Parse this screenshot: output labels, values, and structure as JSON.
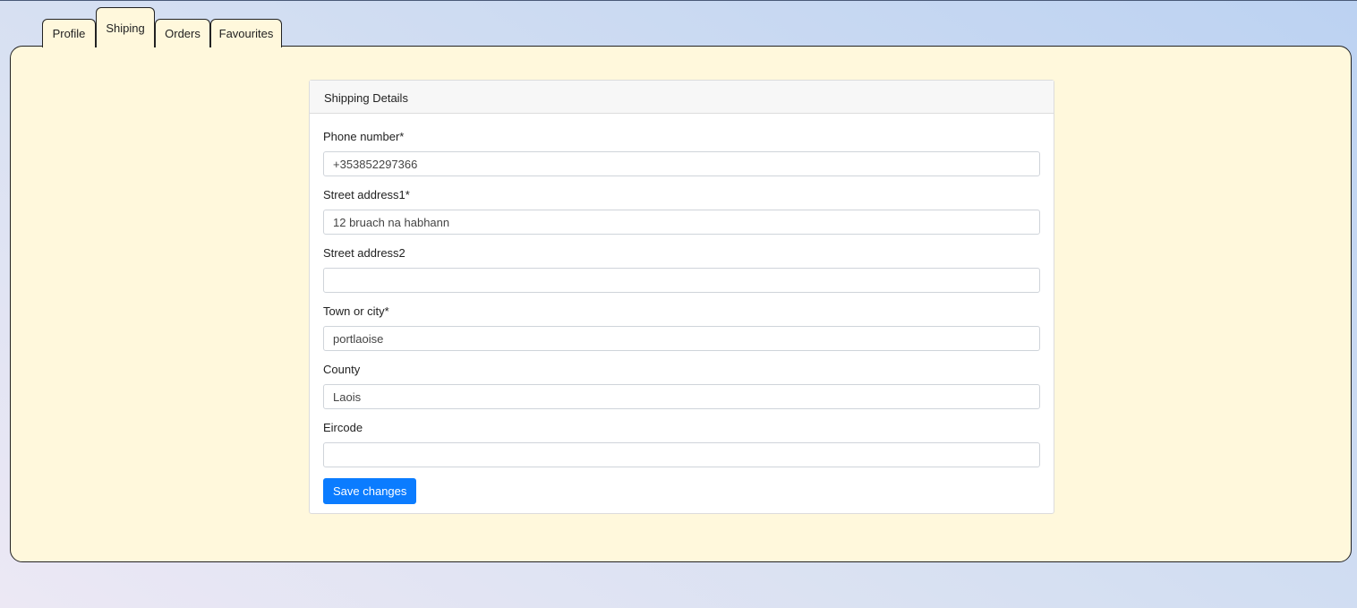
{
  "tabs": [
    {
      "label": "Profile",
      "active": false
    },
    {
      "label": "Shiping",
      "active": true
    },
    {
      "label": "Orders",
      "active": false
    },
    {
      "label": "Favourites",
      "active": false
    }
  ],
  "card": {
    "title": "Shipping Details"
  },
  "form": {
    "phone": {
      "label": "Phone number*",
      "value": "+353852297366"
    },
    "street1": {
      "label": "Street address1*",
      "value": "12 bruach na habhann"
    },
    "street2": {
      "label": "Street address2",
      "value": ""
    },
    "town": {
      "label": "Town or city*",
      "value": "portlaoise"
    },
    "county": {
      "label": "County",
      "value": "Laois"
    },
    "eircode": {
      "label": "Eircode",
      "value": ""
    }
  },
  "save_label": "Save changes",
  "colors": {
    "panel_bg": "#fff8dc",
    "primary_button": "#0b7cff"
  }
}
